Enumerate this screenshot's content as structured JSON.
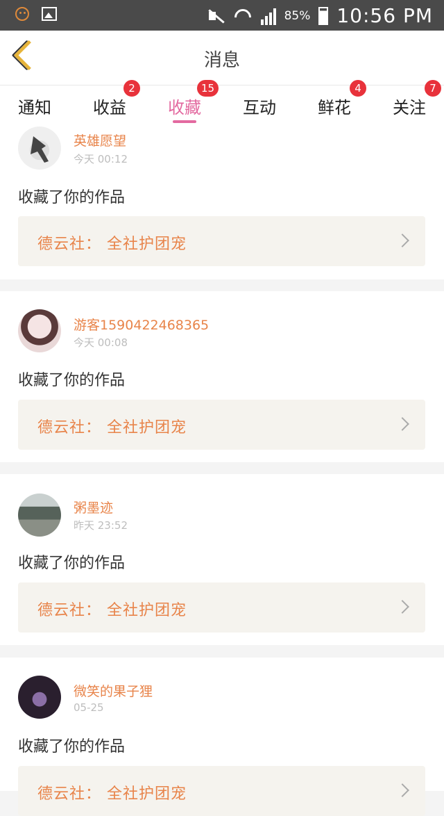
{
  "status_bar": {
    "battery": "85%",
    "time": "10:56 PM"
  },
  "header": {
    "title": "消息"
  },
  "tabs": [
    {
      "label": "通知",
      "badge": ""
    },
    {
      "label": "收益",
      "badge": "2"
    },
    {
      "label": "收藏",
      "badge": "15"
    },
    {
      "label": "互动",
      "badge": ""
    },
    {
      "label": "鲜花",
      "badge": "4"
    },
    {
      "label": "关注",
      "badge": "7"
    }
  ],
  "colors": {
    "accent_tab": "#e36aa0",
    "badge": "#e8323b",
    "username": "#e8844a"
  },
  "messages": [
    {
      "username": "英雄愿望",
      "time": "今天 00:12",
      "text": "收藏了你的作品",
      "work": "德云社： 全社护团宠"
    },
    {
      "username": "游客1590422468365",
      "time": "今天 00:08",
      "text": "收藏了你的作品",
      "work": "德云社： 全社护团宠"
    },
    {
      "username": "粥墨迹",
      "time": "昨天 23:52",
      "text": "收藏了你的作品",
      "work": "德云社： 全社护团宠"
    },
    {
      "username": "微笑的果子狸",
      "time": "05-25",
      "text": "收藏了你的作品",
      "work": "德云社： 全社护团宠"
    }
  ]
}
